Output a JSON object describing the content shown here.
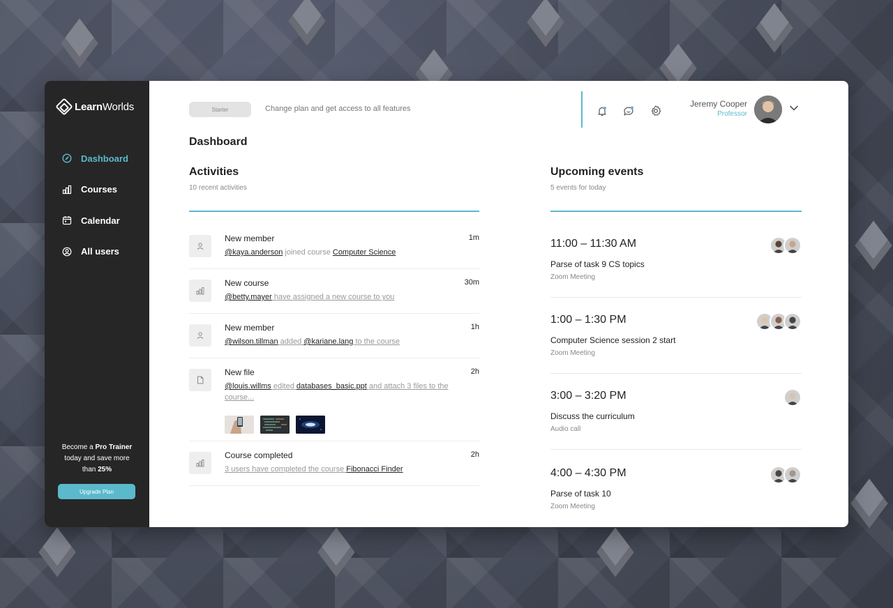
{
  "brand": {
    "name_bold": "Learn",
    "name_rest": "Worlds"
  },
  "sidebar": {
    "items": [
      {
        "label": "Dashboard",
        "icon": "dashboard-icon"
      },
      {
        "label": "Courses",
        "icon": "bar-chart-icon"
      },
      {
        "label": "Calendar",
        "icon": "calendar-icon"
      },
      {
        "label": "All users",
        "icon": "user-circle-icon"
      }
    ],
    "promo": {
      "line1_pre": "Become a ",
      "line1_bold": "Pro Trainer",
      "line2": "today and save more",
      "line3_pre": "than ",
      "line3_bold": "25%"
    },
    "upgrade_label": "Upgrade Plan"
  },
  "topbar": {
    "plan_label": "Starter",
    "plan_note": "Change plan and get access to all features",
    "user_name": "Jeremy Cooper",
    "user_role": "Professor"
  },
  "page_title": "Dashboard",
  "activities": {
    "title": "Activities",
    "subtitle": "10 recent activities",
    "items": [
      {
        "title": "New member",
        "time": "1m",
        "icon": "user-icon",
        "parts": [
          [
            "lnk",
            "@kaya.anderson"
          ],
          [
            "txt",
            " joined course "
          ],
          [
            "lnk",
            "Computer Science"
          ]
        ]
      },
      {
        "title": "New course",
        "time": "30m",
        "icon": "bar-chart-icon",
        "parts": [
          [
            "lnk",
            "@betty.mayer"
          ],
          [
            "mut",
            " have assigned a new course to you"
          ]
        ]
      },
      {
        "title": "New member",
        "time": "1h",
        "icon": "user-icon",
        "parts": [
          [
            "lnk",
            "@wilson.tillman"
          ],
          [
            "mut",
            " added "
          ],
          [
            "lnk",
            "@kariane.lang"
          ],
          [
            "mut",
            " to the course"
          ]
        ]
      },
      {
        "title": "New file",
        "time": "2h",
        "icon": "file-icon",
        "parts": [
          [
            "lnk",
            "@louis.willms"
          ],
          [
            "mut",
            " edited "
          ],
          [
            "lnk",
            "databases_basic.ppt"
          ],
          [
            "mut",
            " and attach 3 files to the course..."
          ]
        ]
      },
      {
        "title": "Course completed",
        "time": "2h",
        "icon": "bar-chart-icon",
        "parts": [
          [
            "mut",
            "3 users have completed the course "
          ],
          [
            "lnk",
            "Fibonacci Finder"
          ]
        ]
      }
    ]
  },
  "events": {
    "title": "Upcoming events",
    "subtitle": "5 events for today",
    "items": [
      {
        "time": "11:00 – 11:30 AM",
        "title": "Parse of task 9 CS topics",
        "type": "Zoom Meeting",
        "avatars": [
          "#c9a58a",
          "#5a4335"
        ]
      },
      {
        "time": "1:00 – 1:30 PM",
        "title": "Computer Science session 2 start",
        "type": "Zoom Meeting",
        "avatars": [
          "#3f4a3c",
          "#8b5e4a",
          "#e2c3a6"
        ]
      },
      {
        "time": "3:00 – 3:20 PM",
        "title": "Discuss the curriculum",
        "type": "Audio call",
        "avatars": [
          "#d8c3b0"
        ]
      },
      {
        "time": "4:00 – 4:30 PM",
        "title": "Parse of task 10",
        "type": "Zoom Meeting",
        "avatars": [
          "#a3968c",
          "#4c4540"
        ]
      }
    ]
  },
  "colors": {
    "accent": "#5bb9cc",
    "sidebar": "#262626"
  }
}
